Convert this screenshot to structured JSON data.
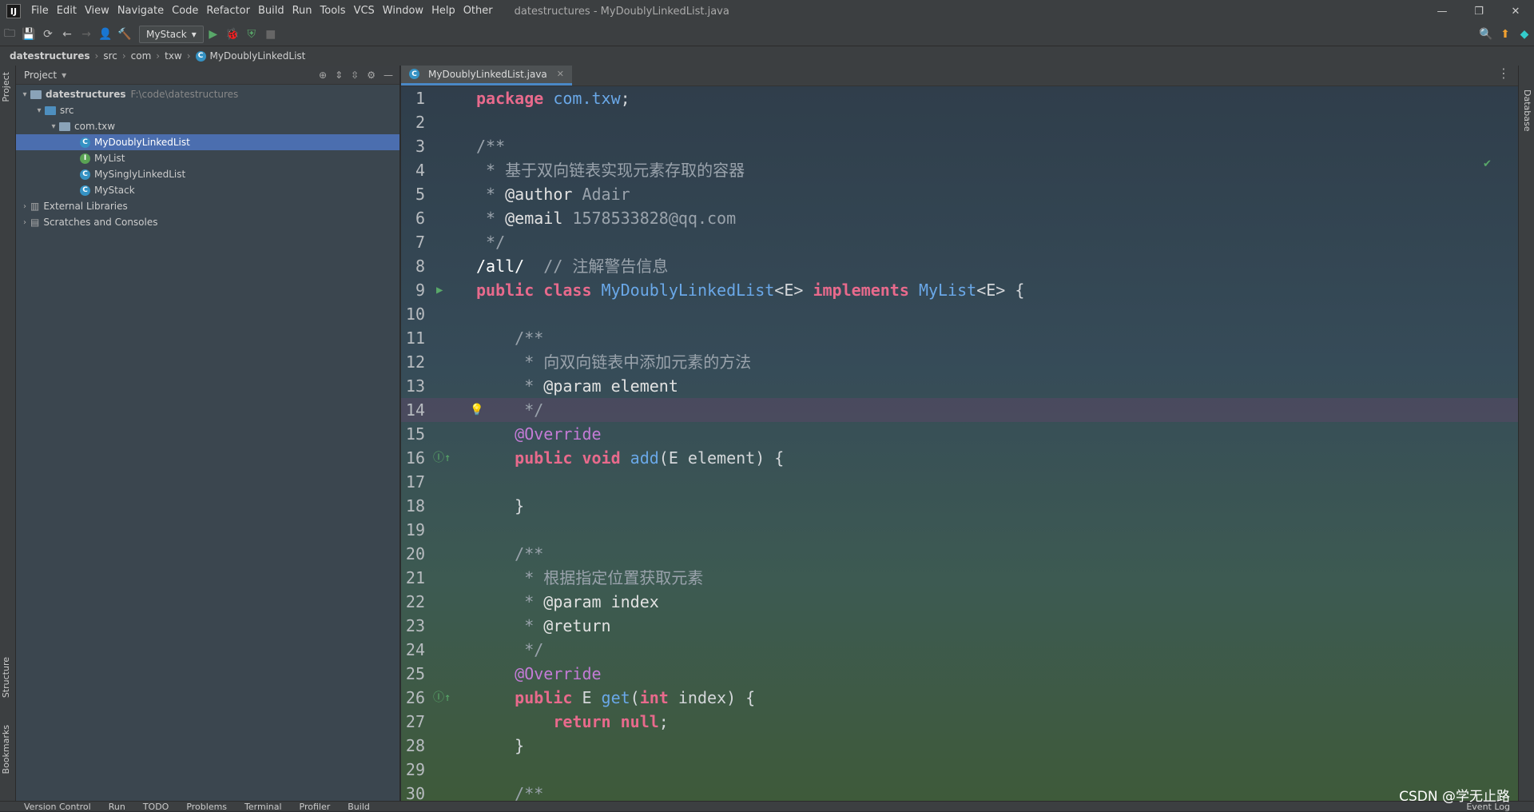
{
  "menubar": {
    "items": [
      "File",
      "Edit",
      "View",
      "Navigate",
      "Code",
      "Refactor",
      "Build",
      "Run",
      "Tools",
      "VCS",
      "Window",
      "Help",
      "Other"
    ],
    "title": "datestructures - MyDoublyLinkedList.java"
  },
  "toolbar": {
    "run_config": "MyStack"
  },
  "breadcrumb": [
    "datestructures",
    "src",
    "com",
    "txw",
    "MyDoublyLinkedList"
  ],
  "project": {
    "header": "Project",
    "root": {
      "name": "datestructures",
      "path": "F:\\code\\datestructures"
    },
    "src": "src",
    "pkg": "com.txw",
    "files": [
      {
        "name": "MyDoublyLinkedList",
        "kind": "class",
        "selected": true
      },
      {
        "name": "MyList",
        "kind": "interface",
        "selected": false
      },
      {
        "name": "MySinglyLinkedList",
        "kind": "class",
        "selected": false
      },
      {
        "name": "MyStack",
        "kind": "class",
        "selected": false
      }
    ],
    "ext_libs": "External Libraries",
    "scratches": "Scratches and Consoles"
  },
  "editor": {
    "tab": "MyDoublyLinkedList.java"
  },
  "code_lines": [
    "1",
    "2",
    "3",
    "4",
    "5",
    "6",
    "7",
    "8",
    "9",
    "10",
    "11",
    "12",
    "13",
    "14",
    "15",
    "16",
    "17",
    "18",
    "19",
    "20",
    "21",
    "22",
    "23",
    "24",
    "25",
    "26",
    "27",
    "28",
    "29",
    "30"
  ],
  "code": {
    "l1a": "package",
    "l1b": "com.txw",
    "l3": "/**",
    "l4": " * 基于双向链表实现元素存取的容器",
    "l5a": " * ",
    "l5b": "@author",
    "l5c": " Adair",
    "l6a": " * ",
    "l6b": "@email",
    "l6c": " 1578533828@qq.com",
    "l7": " */",
    "l8a": "/all/",
    "l8b": "  // 注解警告信息",
    "l9a": "public class",
    "l9b": "MyDoublyLinkedList",
    "l9c": "<E> ",
    "l9d": "implements",
    "l9e": "MyList",
    "l9f": "<E> {",
    "l11": "    /**",
    "l12": "     * 向双向链表中添加元素的方法",
    "l13a": "     * ",
    "l13b": "@param",
    "l13c": " element",
    "l14": "     */",
    "l15": "    @Override",
    "l16a": "    public void ",
    "l16b": "add",
    "l16c": "(E element) {",
    "l18": "    }",
    "l20": "    /**",
    "l21": "     * 根据指定位置获取元素",
    "l22a": "     * ",
    "l22b": "@param",
    "l22c": " index",
    "l23a": "     * ",
    "l23b": "@return",
    "l24": "     */",
    "l25": "    @Override",
    "l26a": "    public ",
    "l26b": "E ",
    "l26c": "get",
    "l26d": "(",
    "l26e": "int",
    "l26f": " index) {",
    "l27a": "        return null",
    "l27b": ";",
    "l28": "    }",
    "l30": "    /**"
  },
  "side": {
    "left": [
      "Project",
      "Structure",
      "Bookmarks"
    ],
    "right": "Database"
  },
  "status": [
    "Version Control",
    "Run",
    "TODO",
    "Problems",
    "Terminal",
    "Profiler",
    "Build"
  ],
  "event_log": "Event Log",
  "watermark": "CSDN @学无止路"
}
